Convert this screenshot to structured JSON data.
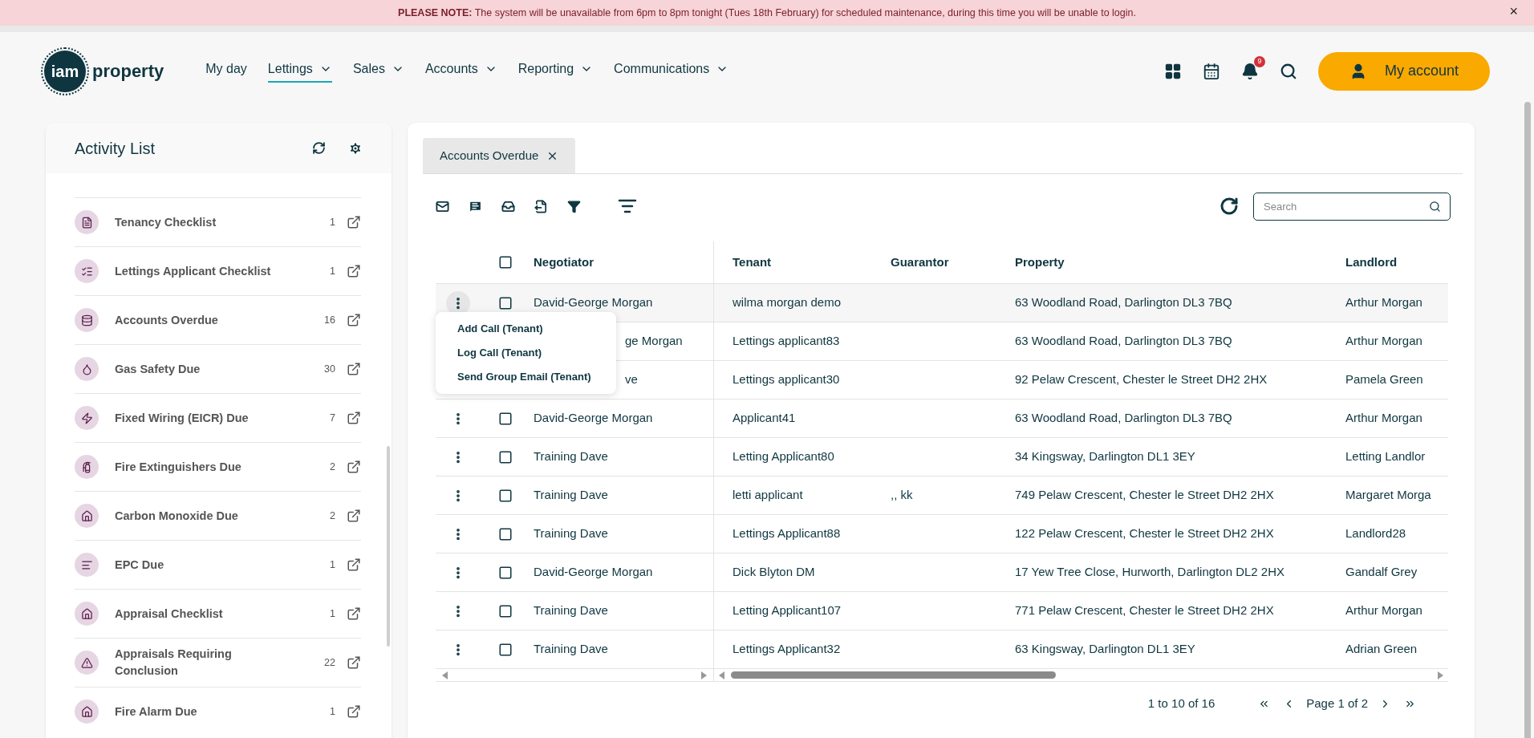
{
  "banner": {
    "text": "**PLEASE NOTE:** The system will be unavailable from 6pm to 8pm tonight (Tues 18th February) for scheduled maintenance, during this time you will be unable to login.",
    "close": "×"
  },
  "header": {
    "logo": {
      "mark": "iam",
      "word": "property"
    },
    "nav": [
      {
        "label": "My day",
        "selected": false,
        "dropdown": false
      },
      {
        "label": "Lettings",
        "selected": true,
        "dropdown": true
      },
      {
        "label": "Sales",
        "selected": false,
        "dropdown": true
      },
      {
        "label": "Accounts",
        "selected": false,
        "dropdown": true
      },
      {
        "label": "Reporting",
        "selected": false,
        "dropdown": true
      },
      {
        "label": "Communications",
        "selected": false,
        "dropdown": true
      }
    ],
    "notification_count": "9",
    "account_button": "My account"
  },
  "sidebar": {
    "title": "Activity List",
    "items": [
      {
        "label": "Tenancy Checklist",
        "count": "1"
      },
      {
        "label": "Lettings Applicant Checklist",
        "count": "1"
      },
      {
        "label": "Accounts Overdue",
        "count": "16"
      },
      {
        "label": "Gas Safety Due",
        "count": "30"
      },
      {
        "label": "Fixed Wiring (EICR) Due",
        "count": "7"
      },
      {
        "label": "Fire Extinguishers Due",
        "count": "2"
      },
      {
        "label": "Carbon Monoxide Due",
        "count": "2"
      },
      {
        "label": "EPC Due",
        "count": "1"
      },
      {
        "label": "Appraisal Checklist",
        "count": "1"
      },
      {
        "label": "Appraisals Requiring Conclusion",
        "count": "22"
      },
      {
        "label": "Fire Alarm Due",
        "count": "1"
      }
    ]
  },
  "tabs": [
    {
      "label": "Accounts Overdue",
      "selected": true,
      "closable": true
    }
  ],
  "search": {
    "placeholder": "Search"
  },
  "row_menu": {
    "items": [
      "Add Call (Tenant)",
      "Log Call (Tenant)",
      "Send Group Email (Tenant)"
    ]
  },
  "table": {
    "all_selected": false,
    "columns": [
      "Negotiator",
      "Tenant",
      "Guarantor",
      "Property",
      "Landlord"
    ],
    "rows": [
      {
        "selected": false,
        "hovered": true,
        "under_menu": false,
        "negotiator": "David-George Morgan",
        "tenant": "wilma morgan demo",
        "property": "63 Woodland Road, Darlington DL3 7BQ",
        "landlord": "Arthur Morgan"
      },
      {
        "hovered": false,
        "under_menu": true,
        "negotiator": "ge Morgan",
        "tenant": "Lettings applicant83",
        "property": "63 Woodland Road, Darlington DL3 7BQ",
        "landlord": "Arthur Morgan"
      },
      {
        "hovered": false,
        "under_menu": true,
        "negotiator": "ve",
        "tenant": "Lettings applicant30",
        "property": "92 Pelaw Crescent, Chester le Street DH2 2HX",
        "landlord": "Pamela Green"
      },
      {
        "selected": false,
        "hovered": false,
        "under_menu": false,
        "negotiator": "David-George Morgan",
        "tenant": "Applicant41",
        "property": "63 Woodland Road, Darlington DL3 7BQ",
        "landlord": "Arthur Morgan"
      },
      {
        "selected": false,
        "hovered": false,
        "under_menu": false,
        "negotiator": "Training Dave",
        "tenant": "Letting Applicant80",
        "property": "34 Kingsway, Darlington DL1 3EY",
        "landlord": "Letting Landlor"
      },
      {
        "selected": false,
        "hovered": false,
        "under_menu": false,
        "negotiator": "Training Dave",
        "tenant": "letti applicant",
        "guarantor": ",, kk",
        "property": "749 Pelaw Crescent, Chester le Street DH2 2HX",
        "landlord": "Margaret Morga"
      },
      {
        "selected": false,
        "hovered": false,
        "under_menu": false,
        "negotiator": "Training Dave",
        "tenant": "Lettings Applicant88",
        "property": "122 Pelaw Crescent, Chester le Street DH2 2HX",
        "landlord": "Landlord28"
      },
      {
        "selected": false,
        "hovered": false,
        "under_menu": false,
        "negotiator": "David-George Morgan",
        "tenant": "Dick Blyton DM",
        "property": "17 Yew Tree Close, Hurworth, Darlington DL2 2HX",
        "landlord": "Gandalf Grey"
      },
      {
        "selected": false,
        "hovered": false,
        "under_menu": false,
        "negotiator": "Training Dave",
        "tenant": "Letting Applicant107",
        "property": "771 Pelaw Crescent, Chester le Street DH2 2HX",
        "landlord": "Arthur Morgan"
      },
      {
        "selected": false,
        "hovered": false,
        "under_menu": false,
        "negotiator": "Training Dave",
        "tenant": "Lettings Applicant32",
        "property": "63 Kingsway, Darlington DL1 3EY",
        "landlord": "Adrian Green"
      }
    ]
  },
  "pagination": {
    "range": "1 to 10 of 16",
    "page": "Page 1 of 2"
  }
}
